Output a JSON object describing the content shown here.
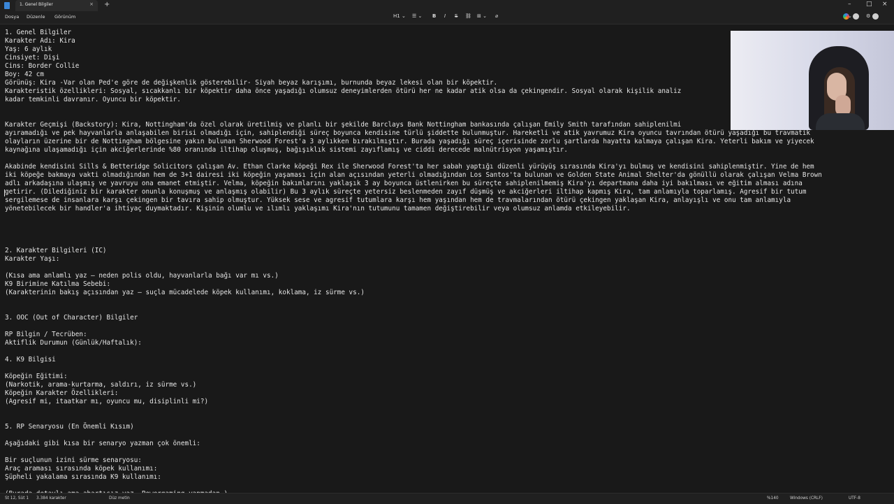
{
  "window": {
    "tab_title": "1. Genel Bilgiler",
    "tab_close": "×",
    "new_tab": "+",
    "controls": {
      "minimize": "–",
      "maximize": "□",
      "close": "×",
      "settings": "⚙"
    }
  },
  "menu": {
    "file": "Dosya",
    "edit": "Düzenle",
    "view": "Görünüm"
  },
  "toolbar": {
    "heading": "H1 ⌄",
    "list": "☰ ⌄",
    "bold": "B",
    "italic": "I",
    "strike": "S",
    "link": "⛓",
    "table": "⊞ ⌄",
    "clear_format": "⌀",
    "more": "⌄",
    "account_dropdown": "⌄"
  },
  "document_lines": [
    "1. Genel Bilgiler",
    "Karakter Adı: Kira",
    "Yaş: 6 aylık",
    "Cinsiyet: Dişi",
    "Cins: Border Collie",
    "Boy: 42 cm",
    "Görünüş: Kira -Var olan Ped'e göre de değişkenlik gösterebilir- Siyah beyaz karışımı, burnunda beyaz lekesi olan bir köpektir.",
    "Karakteristik özellikleri: Sosyal, sıcakkanlı bir köpektir daha önce yaşadığı olumsuz deneyimlerden ötürü her ne kadar atik olsa da çekingendir. Sosyal olarak kişilik analiz",
    "kadar temkinli davranır. Oyuncu bir köpektir.",
    "",
    "",
    "Karakter Geçmişi (Backstory): Kira, Nottingham'da özel olarak üretilmiş ve planlı bir şekilde Barclays Bank Nottingham bankasında çalışan Emily Smith tarafından sahiplenilmi",
    "ayıramadığı ve pek hayvanlarla anlaşabilen birisi olmadığı için, sahiplendiği süreç boyunca kendisine türlü şiddette bulunmuştur. Hareketli ve atik yavrumuz Kira oyuncu tavrından ötürü yaşadığı bu travmatik",
    "olayların üzerine bir de Nottingham bölgesine yakın bulunan Sherwood Forest'a 3 aylıkken bırakılmıştır. Burada yaşadığı süreç içerisinde zorlu şartlarda hayatta kalmaya çalışan Kira. Yeterli bakım ve yiyecek",
    "kaynağına ulaşamadığı için akciğerlerinde %80 oranında iltihap oluşmuş, bağışıklık sistemi zayıflamış ve ciddi derecede malnütrisyon yaşamıştır.",
    "",
    "Akabinde kendisini Sills & Betteridge Solicitors çalışan Av. Ethan Clarke köpeği Rex ile Sherwood Forest'ta her sabah yaptığı düzenli yürüyüş sırasında Kira'yı bulmuş ve kendisini sahiplenmiştir. Yine de hem",
    "iki köpeğe bakmaya vakti olmadığından hem de 3+1 dairesi iki köpeğin yaşaması için alan açısından yeterli olmadığından Los Santos'ta bulunan ve Golden State Animal Shelter'da gönüllü olarak çalışan Velma Brown",
    "adlı arkadaşına ulaşmış ve yavruyu ona emanet etmiştir. Velma, köpeğin bakımlarını yaklaşık 3 ay boyunca üstlenirken bu süreçte sahiplenilmemiş Kira'yı departmana daha iyi bakılması ve eğitim alması adına",
    "getirir. (Dilediğiniz bir karakter onunla konuşmuş ve anlaşmış olabilir) Bu 3 aylık süreçte yetersiz beslenmeden zayıf düşmüş ve akciğerleri iltihap kapmış Kira, tam anlamıyla toparlamış. Agresif bir tutum",
    "sergilemese de insanlara karşı çekingen bir tavıra sahip olmuştur. Yüksek sese ve agresif tutumlara karşı hem yaşından hem de travmalarından ötürü çekingen yaklaşan Kira, anlayışlı ve onu tam anlamıyla",
    "yönetebilecek bir handler'a ihtiyaç duymaktadır. Kişinin olumlu ve ılımlı yaklaşımı Kira'nın tutumunu tamamen değiştirebilir veya olumsuz anlamda etkileyebilir.",
    "",
    "",
    "",
    "",
    "2. Karakter Bilgileri (IC)",
    "Karakter Yaşı:",
    "",
    "(Kısa ama anlamlı yaz — neden polis oldu, hayvanlarla bağı var mı vs.)",
    "K9 Birimine Katılma Sebebi:",
    "(Karakterinin bakış açısından yaz — suçla mücadelede köpek kullanımı, koklama, iz sürme vs.)",
    "",
    "",
    "3. OOC (Out of Character) Bilgiler",
    "",
    "RP Bilgin / Tecrüben:",
    "Aktiflik Durumun (Günlük/Haftalık):",
    "",
    "4. K9 Bilgisi",
    "",
    "Köpeğin Eğitimi:",
    "(Narkotik, arama-kurtarma, saldırı, iz sürme vs.)",
    "Köpeğin Karakter Özellikleri:",
    "(Agresif mi, itaatkar mı, oyuncu mu, disiplinli mi?)",
    "",
    "",
    "5. RP Senaryosu (En Önemli Kısım)",
    "",
    "Aşağıdaki gibi kısa bir senaryo yazman çok önemli:",
    "",
    "Bir suçlunun izini sürme senaryosu:",
    "Araç araması sırasında köpek kullanımı:",
    "Şüpheli yakalama sırasında K9 kullanımı:",
    "",
    "(Burada detaylı ama abartısız yaz. Powergaming yapmadan.)"
  ],
  "status": {
    "position": "St 12, Süt 1",
    "char_count": "3.384 karakter",
    "format": "Düz metin",
    "zoom": "%140",
    "line_ending": "Windows (CRLF)",
    "encoding": "UTF-8"
  }
}
